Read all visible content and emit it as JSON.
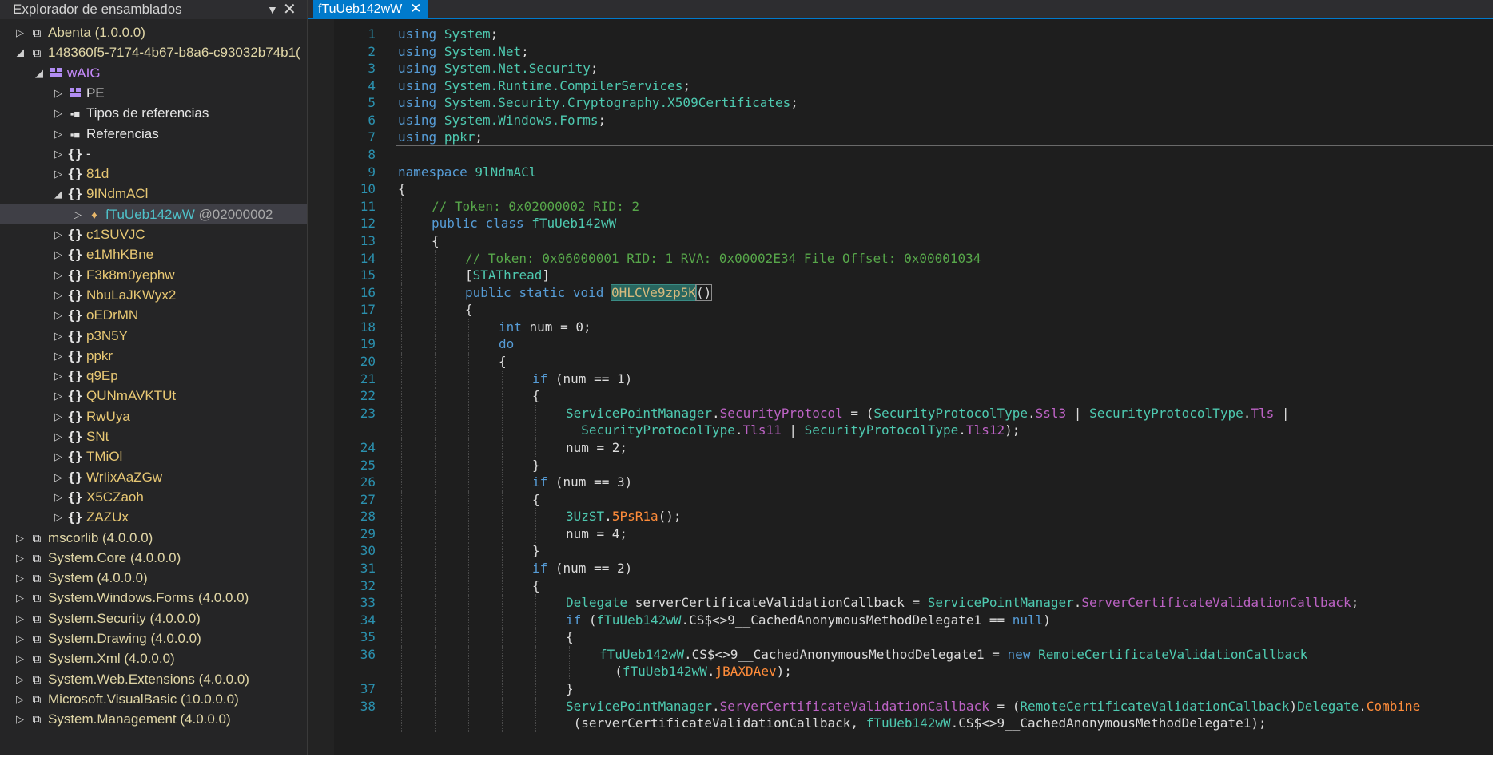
{
  "explorer": {
    "title": "Explorador de ensamblados",
    "dropdown_glyph": "▼",
    "close_glyph": "✕",
    "tree": [
      {
        "label": "Abenta (1.0.0.0)",
        "icon": "assembly-icon",
        "depth": 0,
        "expander": "collapsed",
        "color": "asm"
      },
      {
        "label": "148360f5-7174-4b67-b8a6-c93032b74b1(",
        "icon": "assembly-icon",
        "depth": 0,
        "expander": "expanded",
        "color": "asm"
      },
      {
        "label": "wAIG",
        "icon": "module-icon",
        "depth": 1,
        "expander": "expanded",
        "color": "mod"
      },
      {
        "label": "PE",
        "icon": "module-icon",
        "depth": 2,
        "expander": "collapsed",
        "color": "white"
      },
      {
        "label": "Tipos de referencias",
        "icon": "reference-icon",
        "depth": 2,
        "expander": "collapsed",
        "color": "white"
      },
      {
        "label": "Referencias",
        "icon": "reference-icon",
        "depth": 2,
        "expander": "collapsed",
        "color": "white"
      },
      {
        "label": "-",
        "icon": "namespace-icon",
        "depth": 2,
        "expander": "collapsed",
        "color": "white"
      },
      {
        "label": "81d",
        "icon": "namespace-icon",
        "depth": 2,
        "expander": "collapsed",
        "color": "ns"
      },
      {
        "label": "9INdmACl",
        "icon": "namespace-icon",
        "depth": 2,
        "expander": "expanded",
        "color": "ns"
      },
      {
        "label": "fTuUeb142wW",
        "token": "@02000002",
        "icon": "class-icon",
        "depth": 3,
        "expander": "collapsed",
        "color": "class",
        "selected": true
      },
      {
        "label": "c1SUVJC",
        "icon": "namespace-icon",
        "depth": 2,
        "expander": "collapsed",
        "color": "ns"
      },
      {
        "label": "e1MhKBne",
        "icon": "namespace-icon",
        "depth": 2,
        "expander": "collapsed",
        "color": "ns"
      },
      {
        "label": "F3k8m0yephw",
        "icon": "namespace-icon",
        "depth": 2,
        "expander": "collapsed",
        "color": "ns"
      },
      {
        "label": "NbuLaJKWyx2",
        "icon": "namespace-icon",
        "depth": 2,
        "expander": "collapsed",
        "color": "ns"
      },
      {
        "label": "oEDrMN",
        "icon": "namespace-icon",
        "depth": 2,
        "expander": "collapsed",
        "color": "ns"
      },
      {
        "label": "p3N5Y",
        "icon": "namespace-icon",
        "depth": 2,
        "expander": "collapsed",
        "color": "ns"
      },
      {
        "label": "ppkr",
        "icon": "namespace-icon",
        "depth": 2,
        "expander": "collapsed",
        "color": "ns"
      },
      {
        "label": "q9Ep",
        "icon": "namespace-icon",
        "depth": 2,
        "expander": "collapsed",
        "color": "ns"
      },
      {
        "label": "QUNmAVKTUt",
        "icon": "namespace-icon",
        "depth": 2,
        "expander": "collapsed",
        "color": "ns"
      },
      {
        "label": "RwUya",
        "icon": "namespace-icon",
        "depth": 2,
        "expander": "collapsed",
        "color": "ns"
      },
      {
        "label": "SNt",
        "icon": "namespace-icon",
        "depth": 2,
        "expander": "collapsed",
        "color": "ns"
      },
      {
        "label": "TMiOl",
        "icon": "namespace-icon",
        "depth": 2,
        "expander": "collapsed",
        "color": "ns"
      },
      {
        "label": "WrIixAaZGw",
        "icon": "namespace-icon",
        "depth": 2,
        "expander": "collapsed",
        "color": "ns"
      },
      {
        "label": "X5CZaoh",
        "icon": "namespace-icon",
        "depth": 2,
        "expander": "collapsed",
        "color": "ns"
      },
      {
        "label": "ZAZUx",
        "icon": "namespace-icon",
        "depth": 2,
        "expander": "collapsed",
        "color": "ns"
      },
      {
        "label": "mscorlib (4.0.0.0)",
        "icon": "assembly-icon",
        "depth": 0,
        "expander": "collapsed",
        "color": "asm"
      },
      {
        "label": "System.Core (4.0.0.0)",
        "icon": "assembly-icon",
        "depth": 0,
        "expander": "collapsed",
        "color": "asm"
      },
      {
        "label": "System (4.0.0.0)",
        "icon": "assembly-icon",
        "depth": 0,
        "expander": "collapsed",
        "color": "asm"
      },
      {
        "label": "System.Windows.Forms (4.0.0.0)",
        "icon": "assembly-icon",
        "depth": 0,
        "expander": "collapsed",
        "color": "asm"
      },
      {
        "label": "System.Security (4.0.0.0)",
        "icon": "assembly-icon",
        "depth": 0,
        "expander": "collapsed",
        "color": "asm"
      },
      {
        "label": "System.Drawing (4.0.0.0)",
        "icon": "assembly-icon",
        "depth": 0,
        "expander": "collapsed",
        "color": "asm"
      },
      {
        "label": "System.Xml (4.0.0.0)",
        "icon": "assembly-icon",
        "depth": 0,
        "expander": "collapsed",
        "color": "asm"
      },
      {
        "label": "System.Web.Extensions (4.0.0.0)",
        "icon": "assembly-icon",
        "depth": 0,
        "expander": "collapsed",
        "color": "asm"
      },
      {
        "label": "Microsoft.VisualBasic (10.0.0.0)",
        "icon": "assembly-icon",
        "depth": 0,
        "expander": "collapsed",
        "color": "asm"
      },
      {
        "label": "System.Management (4.0.0.0)",
        "icon": "assembly-icon",
        "depth": 0,
        "expander": "collapsed",
        "color": "asm"
      }
    ]
  },
  "editor": {
    "tab": {
      "label": "fTuUeb142wW",
      "close_glyph": "✕"
    },
    "lines": [
      {
        "n": "1",
        "indent": 0,
        "tokens": [
          [
            "kw",
            "using"
          ],
          [
            "pl",
            " "
          ],
          [
            "tp",
            "System"
          ],
          [
            "pl",
            ";"
          ]
        ]
      },
      {
        "n": "2",
        "indent": 0,
        "tokens": [
          [
            "kw",
            "using"
          ],
          [
            "pl",
            " "
          ],
          [
            "tp",
            "System.Net"
          ],
          [
            "pl",
            ";"
          ]
        ]
      },
      {
        "n": "3",
        "indent": 0,
        "tokens": [
          [
            "kw",
            "using"
          ],
          [
            "pl",
            " "
          ],
          [
            "tp",
            "System.Net.Security"
          ],
          [
            "pl",
            ";"
          ]
        ]
      },
      {
        "n": "4",
        "indent": 0,
        "tokens": [
          [
            "kw",
            "using"
          ],
          [
            "pl",
            " "
          ],
          [
            "tp",
            "System.Runtime.CompilerServices"
          ],
          [
            "pl",
            ";"
          ]
        ]
      },
      {
        "n": "5",
        "indent": 0,
        "tokens": [
          [
            "kw",
            "using"
          ],
          [
            "pl",
            " "
          ],
          [
            "tp",
            "System.Security.Cryptography.X509Certificates"
          ],
          [
            "pl",
            ";"
          ]
        ]
      },
      {
        "n": "6",
        "indent": 0,
        "tokens": [
          [
            "kw",
            "using"
          ],
          [
            "pl",
            " "
          ],
          [
            "tp",
            "System.Windows.Forms"
          ],
          [
            "pl",
            ";"
          ]
        ]
      },
      {
        "n": "7",
        "indent": 0,
        "tokens": [
          [
            "kw",
            "using"
          ],
          [
            "pl",
            " "
          ],
          [
            "tp",
            "ppkr"
          ],
          [
            "pl",
            ";"
          ]
        ],
        "separator_after": true
      },
      {
        "n": "8",
        "indent": 0,
        "tokens": []
      },
      {
        "n": "9",
        "indent": 0,
        "tokens": [
          [
            "kw",
            "namespace"
          ],
          [
            "pl",
            " "
          ],
          [
            "tp",
            "9lNdmACl"
          ]
        ]
      },
      {
        "n": "10",
        "indent": 0,
        "tokens": [
          [
            "pl",
            "{"
          ]
        ]
      },
      {
        "n": "11",
        "indent": 1,
        "tokens": [
          [
            "cm",
            "// Token: 0x02000002 RID: 2"
          ]
        ]
      },
      {
        "n": "12",
        "indent": 1,
        "tokens": [
          [
            "kw",
            "public"
          ],
          [
            "pl",
            " "
          ],
          [
            "kw",
            "class"
          ],
          [
            "pl",
            " "
          ],
          [
            "cl",
            "fTuUeb142wW"
          ]
        ]
      },
      {
        "n": "13",
        "indent": 1,
        "tokens": [
          [
            "pl",
            "{"
          ]
        ]
      },
      {
        "n": "14",
        "indent": 2,
        "tokens": [
          [
            "cm",
            "// Token: 0x06000001 RID: 1 RVA: 0x00002E34 File Offset: 0x00001034"
          ]
        ]
      },
      {
        "n": "15",
        "indent": 2,
        "tokens": [
          [
            "pl",
            "["
          ],
          [
            "cl",
            "STAThread"
          ],
          [
            "pl",
            "]"
          ]
        ]
      },
      {
        "n": "16",
        "indent": 2,
        "tokens": [
          [
            "kw",
            "public"
          ],
          [
            "pl",
            " "
          ],
          [
            "kw",
            "static"
          ],
          [
            "pl",
            " "
          ],
          [
            "kw",
            "void"
          ],
          [
            "pl",
            " "
          ],
          [
            "hl",
            "0HLCVe9zp5K"
          ],
          [
            "sel",
            "()"
          ]
        ]
      },
      {
        "n": "17",
        "indent": 2,
        "tokens": [
          [
            "pl",
            "{"
          ]
        ]
      },
      {
        "n": "18",
        "indent": 3,
        "tokens": [
          [
            "kw",
            "int"
          ],
          [
            "pl",
            " num = 0;"
          ]
        ]
      },
      {
        "n": "19",
        "indent": 3,
        "tokens": [
          [
            "kw",
            "do"
          ]
        ]
      },
      {
        "n": "20",
        "indent": 3,
        "tokens": [
          [
            "pl",
            "{"
          ]
        ]
      },
      {
        "n": "21",
        "indent": 4,
        "tokens": [
          [
            "kw",
            "if"
          ],
          [
            "pl",
            " (num == 1)"
          ]
        ]
      },
      {
        "n": "22",
        "indent": 4,
        "tokens": [
          [
            "pl",
            "{"
          ]
        ]
      },
      {
        "n": "23",
        "indent": 5,
        "tokens": [
          [
            "cl",
            "ServicePointManager"
          ],
          [
            "pl",
            "."
          ],
          [
            "pr",
            "SecurityProtocol"
          ],
          [
            "pl",
            " = ("
          ],
          [
            "cl",
            "SecurityProtocolType"
          ],
          [
            "pl",
            "."
          ],
          [
            "pr",
            "Ssl3"
          ],
          [
            "pl",
            " | "
          ],
          [
            "cl",
            "SecurityProtocolType"
          ],
          [
            "pl",
            "."
          ],
          [
            "pr",
            "Tls"
          ],
          [
            "pl",
            " |"
          ]
        ]
      },
      {
        "n": "",
        "indent": 5,
        "extra": "  ",
        "tokens": [
          [
            "cl",
            "SecurityProtocolType"
          ],
          [
            "pl",
            "."
          ],
          [
            "pr",
            "Tls11"
          ],
          [
            "pl",
            " | "
          ],
          [
            "cl",
            "SecurityProtocolType"
          ],
          [
            "pl",
            "."
          ],
          [
            "pr",
            "Tls12"
          ],
          [
            "pl",
            ");"
          ]
        ]
      },
      {
        "n": "24",
        "indent": 5,
        "tokens": [
          [
            "pl",
            "num = 2;"
          ]
        ]
      },
      {
        "n": "25",
        "indent": 4,
        "tokens": [
          [
            "pl",
            "}"
          ]
        ]
      },
      {
        "n": "26",
        "indent": 4,
        "tokens": [
          [
            "kw",
            "if"
          ],
          [
            "pl",
            " (num == 3)"
          ]
        ]
      },
      {
        "n": "27",
        "indent": 4,
        "tokens": [
          [
            "pl",
            "{"
          ]
        ]
      },
      {
        "n": "28",
        "indent": 5,
        "tokens": [
          [
            "cl",
            "3UzST"
          ],
          [
            "pl",
            "."
          ],
          [
            "mt",
            "5PsR1a"
          ],
          [
            "pl",
            "();"
          ]
        ]
      },
      {
        "n": "29",
        "indent": 5,
        "tokens": [
          [
            "pl",
            "num = 4;"
          ]
        ]
      },
      {
        "n": "30",
        "indent": 4,
        "tokens": [
          [
            "pl",
            "}"
          ]
        ]
      },
      {
        "n": "31",
        "indent": 4,
        "tokens": [
          [
            "kw",
            "if"
          ],
          [
            "pl",
            " (num == 2)"
          ]
        ]
      },
      {
        "n": "32",
        "indent": 4,
        "tokens": [
          [
            "pl",
            "{"
          ]
        ]
      },
      {
        "n": "33",
        "indent": 5,
        "tokens": [
          [
            "cl",
            "Delegate"
          ],
          [
            "pl",
            " serverCertificateValidationCallback = "
          ],
          [
            "cl",
            "ServicePointManager"
          ],
          [
            "pl",
            "."
          ],
          [
            "pr",
            "ServerCertificateValidationCallback"
          ],
          [
            "pl",
            ";"
          ]
        ]
      },
      {
        "n": "34",
        "indent": 5,
        "tokens": [
          [
            "kw",
            "if"
          ],
          [
            "pl",
            " ("
          ],
          [
            "cl",
            "fTuUeb142wW"
          ],
          [
            "pl",
            ".CS$<>9__CachedAnonymousMethodDelegate1 == "
          ],
          [
            "kw",
            "null"
          ],
          [
            "pl",
            ")"
          ]
        ]
      },
      {
        "n": "35",
        "indent": 5,
        "tokens": [
          [
            "pl",
            "{"
          ]
        ]
      },
      {
        "n": "36",
        "indent": 6,
        "tokens": [
          [
            "cl",
            "fTuUeb142wW"
          ],
          [
            "pl",
            ".CS$<>9__CachedAnonymousMethodDelegate1 = "
          ],
          [
            "kw",
            "new"
          ],
          [
            "pl",
            " "
          ],
          [
            "cl",
            "RemoteCertificateValidationCallback"
          ]
        ]
      },
      {
        "n": "",
        "indent": 6,
        "extra": "  ",
        "tokens": [
          [
            "pl",
            "("
          ],
          [
            "cl",
            "fTuUeb142wW"
          ],
          [
            "pl",
            "."
          ],
          [
            "mt",
            "jBAXDAev"
          ],
          [
            "pl",
            ");"
          ]
        ]
      },
      {
        "n": "37",
        "indent": 5,
        "tokens": [
          [
            "pl",
            "}"
          ]
        ]
      },
      {
        "n": "38",
        "indent": 5,
        "tokens": [
          [
            "cl",
            "ServicePointManager"
          ],
          [
            "pl",
            "."
          ],
          [
            "pr",
            "ServerCertificateValidationCallback"
          ],
          [
            "pl",
            " = ("
          ],
          [
            "cl",
            "RemoteCertificateValidationCallback"
          ],
          [
            "pl",
            ")"
          ],
          [
            "cl",
            "Delegate"
          ],
          [
            "pl",
            "."
          ],
          [
            "mt",
            "Combine"
          ]
        ]
      },
      {
        "n": "",
        "indent": 5,
        "extra": " ",
        "tokens": [
          [
            "pl",
            "(serverCertificateValidationCallback, "
          ],
          [
            "cl",
            "fTuUeb142wW"
          ],
          [
            "pl",
            ".CS$<>9__CachedAnonymousMethodDelegate1);"
          ]
        ]
      }
    ]
  }
}
